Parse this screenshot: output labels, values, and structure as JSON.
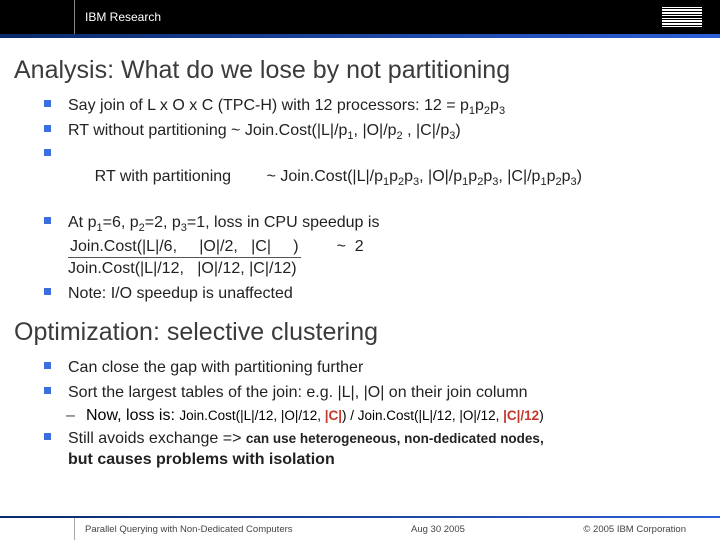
{
  "header": {
    "brand": "IBM Research"
  },
  "section1": {
    "title": "Analysis: What do we lose by not partitioning",
    "b1_pre": "Say  join of L x O x  C (TPC-H) with 12 processors: 12 = p",
    "b1_s1": "1",
    "b1_m1": "p",
    "b1_s2": "2",
    "b1_m2": "p",
    "b1_s3": "3",
    "b2_pre": "RT without partitioning ~ Join.Cost(|L|/p",
    "b2_s1": "1",
    "b2_m1": ", |O|/p",
    "b2_s2": "2",
    "b2_m2": " , |C|/p",
    "b2_s3": "3",
    "b2_end": ")",
    "b3_pre": "RT with partitioning        ~ Join.Cost(|L|/p",
    "b3_g": "1",
    "b3_g2": "p",
    "b3_g3": "2",
    "b3_g4": "p",
    "b3_g5": "3",
    "b3_m1": ", |O|/p",
    "b3_m2": ", |C|/p",
    "b3_end": ")",
    "b4_pre": "At p",
    "b4_s1": "1",
    "b4_m1": "=6, p",
    "b4_s2": "2",
    "b4_m2": "=2, p",
    "b4_s3": "3",
    "b4_m3": "=1, loss in CPU speedup is",
    "frac_top": "Join.Cost(|L|/6,     |O|/2,   |C|     )",
    "frac_bot": "Join.Cost(|L|/12,   |O|/12, |C|/12)",
    "frac_approx": "~  2",
    "b5": "Note: I/O speedup is unaffected"
  },
  "section2": {
    "title": "Optimization: selective clustering",
    "b1": "Can close the gap with partitioning further",
    "b2": "Sort the largest tables of the join: e.g. |L|, |O| on their join column",
    "dash_pre": "Now, loss is: ",
    "dash_small_a": "Join.Cost(|L|/12, |O|/12, ",
    "dash_hl1": "|C|",
    "dash_small_b": ")  / Join.Cost(|L|/12, |O|/12, ",
    "dash_hl2": "|C|/12",
    "dash_small_c": ")",
    "b3_a": "Still avoids exchange => ",
    "b3_b": "can use heterogeneous, non-dedicated nodes,",
    "b3_c": "but causes problems with isolation"
  },
  "footer": {
    "left": "Parallel Querying with Non-Dedicated Computers",
    "center": "Aug 30 2005",
    "right": "© 2005 IBM Corporation"
  }
}
